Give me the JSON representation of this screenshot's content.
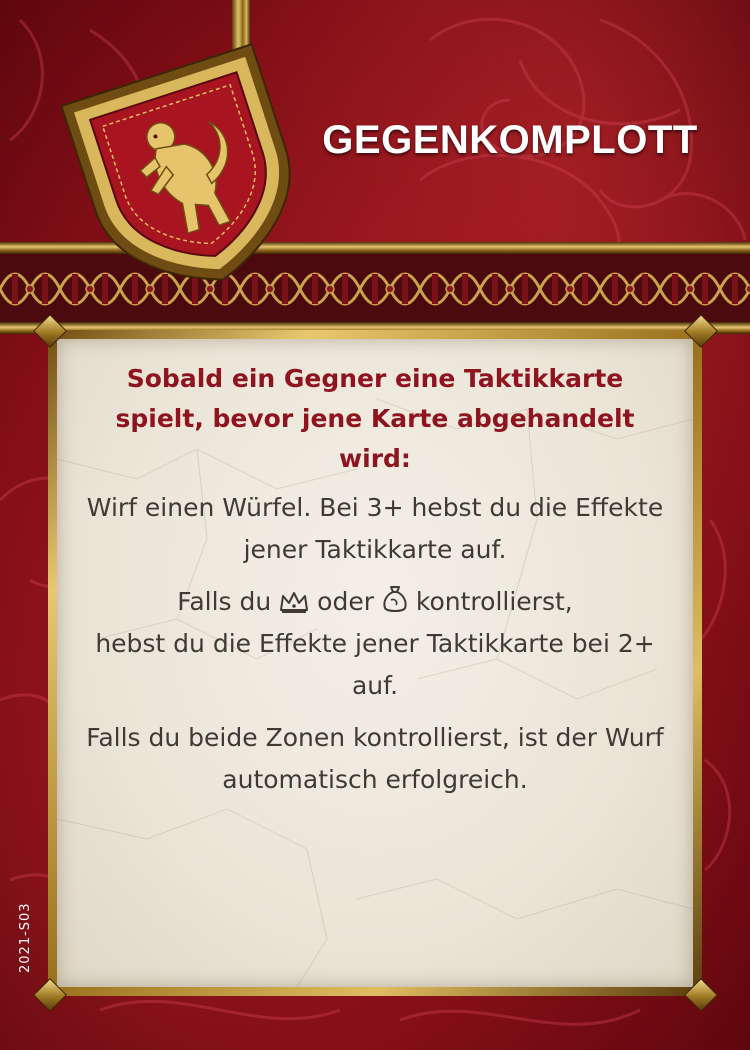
{
  "card": {
    "title": "GEGENKOMPLOTT",
    "trigger": "Sobald ein Gegner eine Taktikkarte spielt, bevor jene Karte abgehandelt wird:",
    "effect": "Wirf einen Würfel. Bei 3+ hebst du die Effekte jener Taktikkarte auf.",
    "bonus_prefix": "Falls du",
    "bonus_mid": "oder",
    "bonus_suffix": "kontrollierst,",
    "bonus_rest": "hebst du die Effekte jener Taktikkarte bei 2+ auf.",
    "final": "Falls du beide Zonen kontrollierst, ist der Wurf automatisch erfolgreich.",
    "code": "2021-S03"
  },
  "icons": [
    "crown-icon",
    "money-bag-icon",
    "lion-crest-icon"
  ],
  "colors": {
    "background_red": "#a3161f",
    "gold": "#e2c36a",
    "trigger_text": "#8e1520",
    "body_text": "#3e3a35",
    "panel": "#ebe5d8"
  }
}
